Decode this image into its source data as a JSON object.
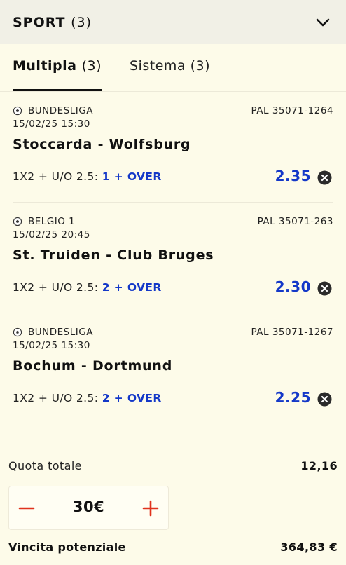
{
  "header": {
    "title": "SPORT",
    "count": "(3)",
    "toggle_icon": "chevron-down-icon"
  },
  "tabs": [
    {
      "label": "Multipla",
      "count": "(3)",
      "active": true
    },
    {
      "label": "Sistema",
      "count": "(3)",
      "active": false
    }
  ],
  "bets": [
    {
      "sport_icon": "soccer-ball-icon",
      "league": "BUNDESLIGA",
      "pal": "PAL 35071-1264",
      "datetime": "15/02/25 15:30",
      "match": "Stoccarda - Wolfsburg",
      "market": "1X2 + U/O 2.5:",
      "selection": "1 + OVER",
      "odd": "2.35"
    },
    {
      "sport_icon": "soccer-ball-icon",
      "league": "BELGIO 1",
      "pal": "PAL 35071-263",
      "datetime": "15/02/25 20:45",
      "match": "St. Truiden - Club Bruges",
      "market": "1X2 + U/O 2.5:",
      "selection": "2 + OVER",
      "odd": "2.30"
    },
    {
      "sport_icon": "soccer-ball-icon",
      "league": "BUNDESLIGA",
      "pal": "PAL 35071-1267",
      "datetime": "15/02/25 15:30",
      "match": "Bochum - Dortmund",
      "market": "1X2 + U/O 2.5:",
      "selection": "2 + OVER",
      "odd": "2.25"
    }
  ],
  "summary": {
    "total_odds_label": "Quota totale",
    "total_odds_value": "12,16",
    "stake_value": "30€",
    "potential_win_label": "Vincita potenziale",
    "potential_win_value": "364,83 €"
  },
  "colors": {
    "accent": "#1438c8",
    "stepper": "#e0321c",
    "background": "#fdfbe9",
    "header_bg": "#f1f0e6"
  }
}
